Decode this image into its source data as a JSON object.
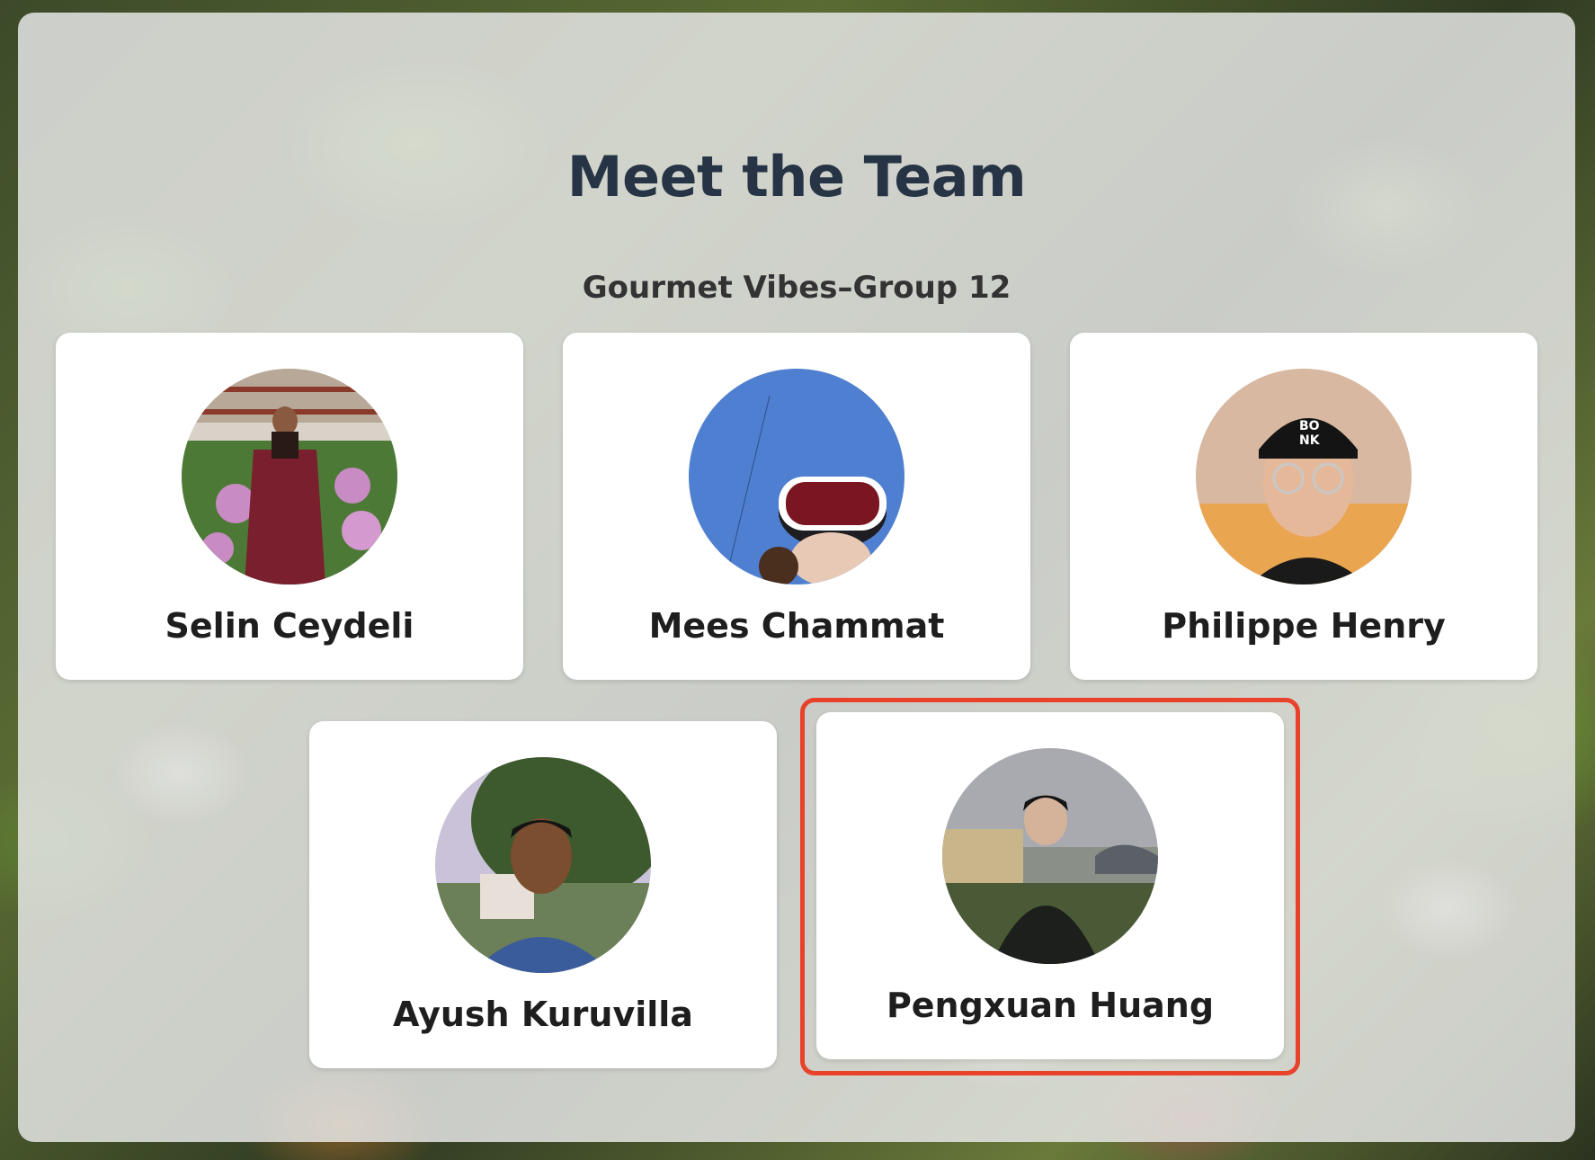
{
  "header": {
    "title": "Meet the Team",
    "subtitle": "Gourmet Vibes–Group 12"
  },
  "team": [
    {
      "name": "Selin Ceydeli",
      "avatar_icon": "team-member-photo"
    },
    {
      "name": "Mees Chammat",
      "avatar_icon": "team-member-photo"
    },
    {
      "name": "Philippe Henry",
      "avatar_icon": "team-member-photo"
    },
    {
      "name": "Ayush Kuruvilla",
      "avatar_icon": "team-member-photo"
    },
    {
      "name": "Pengxuan Huang",
      "avatar_icon": "team-member-photo"
    }
  ],
  "colors": {
    "title": "#263445",
    "highlight": "#e8432a",
    "card": "#ffffff"
  }
}
